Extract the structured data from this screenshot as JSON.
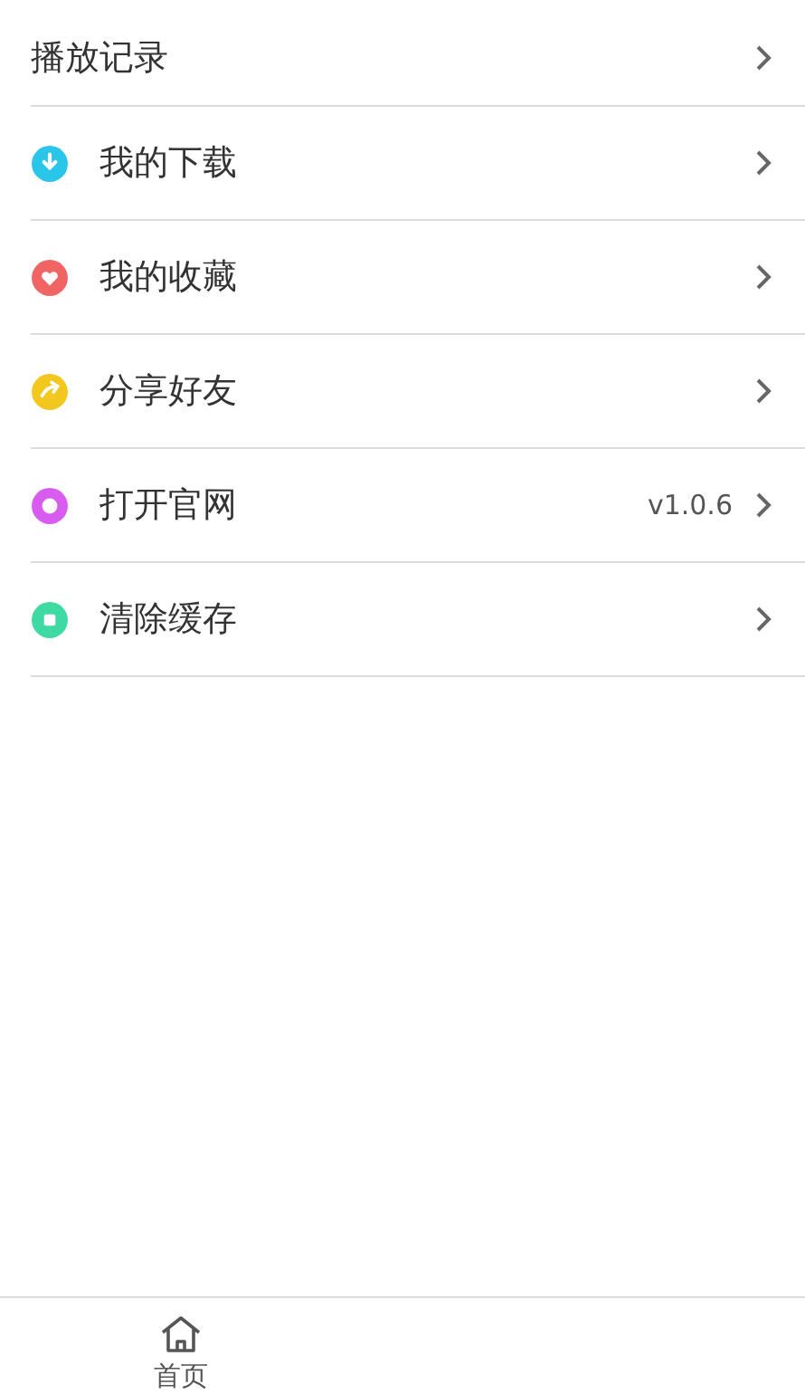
{
  "menu": [
    {
      "label": "播放记录",
      "kind": "plain"
    },
    {
      "label": "我的下载",
      "kind": "download",
      "color": "#29c6ea"
    },
    {
      "label": "我的收藏",
      "kind": "heart",
      "color": "#f06464"
    },
    {
      "label": "分享好友",
      "kind": "share",
      "color": "#f2c81e"
    },
    {
      "label": "打开官网",
      "kind": "globe",
      "color": "#d95cf0",
      "value": "v1.0.6"
    },
    {
      "label": "清除缓存",
      "kind": "clear",
      "color": "#3fd9a3"
    }
  ],
  "bottom_nav": [
    {
      "label": "首页",
      "kind": "home"
    }
  ]
}
